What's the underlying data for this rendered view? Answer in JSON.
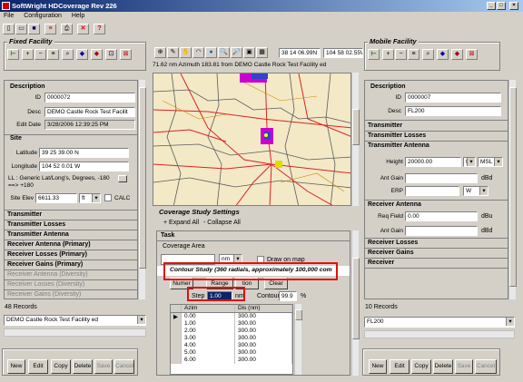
{
  "app": {
    "title": "SoftWright HDCoverage Rev 226"
  },
  "menu": [
    "File",
    "Configuration",
    "Help"
  ],
  "fixed": {
    "title": "Fixed Facility",
    "description_header": "Description",
    "id_label": "ID",
    "id": "0000072",
    "desc_label": "Desc",
    "desc": "DEMO Castle Rock Test Facilit",
    "edit_label": "Edit Date",
    "edit_date": "3/28/2006 12:39:25 PM",
    "site_header": "Site",
    "lat_label": "Latitude",
    "lat": "39 25 39.00 N",
    "lon_label": "Longitude",
    "lon": "104 52 0.01 W",
    "ll_note": "LL : Generic Lat/Long's, Degrees, -180 ==> +180",
    "elev_label": "Site Elev",
    "elev": "6611.33",
    "elev_unit": "ft",
    "calc": "CALC",
    "sections": [
      "Transmitter",
      "Transmitter Losses",
      "Transmitter Antenna",
      "Receiver Antenna (Primary)",
      "Receiver Losses (Primary)",
      "Receiver Gains (Primary)"
    ],
    "sections_dis": [
      "Receiver Antenna (Diversity)",
      "Receiver Losses (Diversity)",
      "Receiver Gains (Diversity)"
    ],
    "records": "48 Records",
    "selected": "DEMO Castle Rock Test Facility ed"
  },
  "mobile": {
    "title": "Mobile Facility",
    "description_header": "Description",
    "id_label": "ID",
    "id": "0000007",
    "desc_label": "Desc",
    "desc": "FL200",
    "sections": [
      "Transmitter",
      "Transmitter Losses"
    ],
    "tx_ant_header": "Transmitter Antenna",
    "height_label": "Height",
    "height": "20000.00",
    "height_unit": "ft",
    "height_ref": "MSL",
    "antgain_label": "Ant Gain",
    "antgain_unit": "dBd",
    "erp_label": "ERP",
    "erp_unit": "W",
    "rx_ant_header": "Receiver Antenna",
    "reqfield_label": "Req Field",
    "reqfield": "0.00",
    "reqfield_unit": "dBu",
    "rxgain_label": "Ant Gain",
    "rxgain_unit": "dBd",
    "sections2": [
      "Receiver Losses",
      "Receiver Gains",
      "Receiver"
    ],
    "records": "10 Records",
    "selected": "FL200"
  },
  "map": {
    "lat_box": "38 14 06.99N",
    "lon_box": "104 58 02.55W",
    "status": "71.62 nm Azimuth 183.81 from DEMO Castle Rock Test Facility ed"
  },
  "study": {
    "title": "Coverage Study Settings",
    "expand": "+ Expand All",
    "collapse": "- Collapse All",
    "task": "Task",
    "area": "Coverage Area",
    "unit": "nm",
    "draw_on_map": "Draw on map",
    "contour_text": "Contour Study (360 radials, approximately 100,000 com",
    "btn_numeric": "Numer",
    "btn_range": "Range",
    "btn_option": "tion",
    "btn_clear": "Clear",
    "step_label": "Step",
    "step": "1.00",
    "step_unit": "nm",
    "contour_label": "Contour",
    "contour": "99.9",
    "contour_unit": "%",
    "col_azim": "Azim",
    "col_dis": "Dis (nm)",
    "rows": [
      [
        "0.00",
        "300.00"
      ],
      [
        "1.00",
        "300.00"
      ],
      [
        "2.00",
        "300.00"
      ],
      [
        "3.00",
        "300.00"
      ],
      [
        "4.00",
        "300.00"
      ],
      [
        "5.00",
        "300.00"
      ],
      [
        "6.00",
        "300.00"
      ]
    ]
  },
  "buttons": {
    "new": "New",
    "edit": "Edit",
    "copy": "Copy",
    "delete": "Delete",
    "save": "Save",
    "cancel": "Cancel"
  }
}
